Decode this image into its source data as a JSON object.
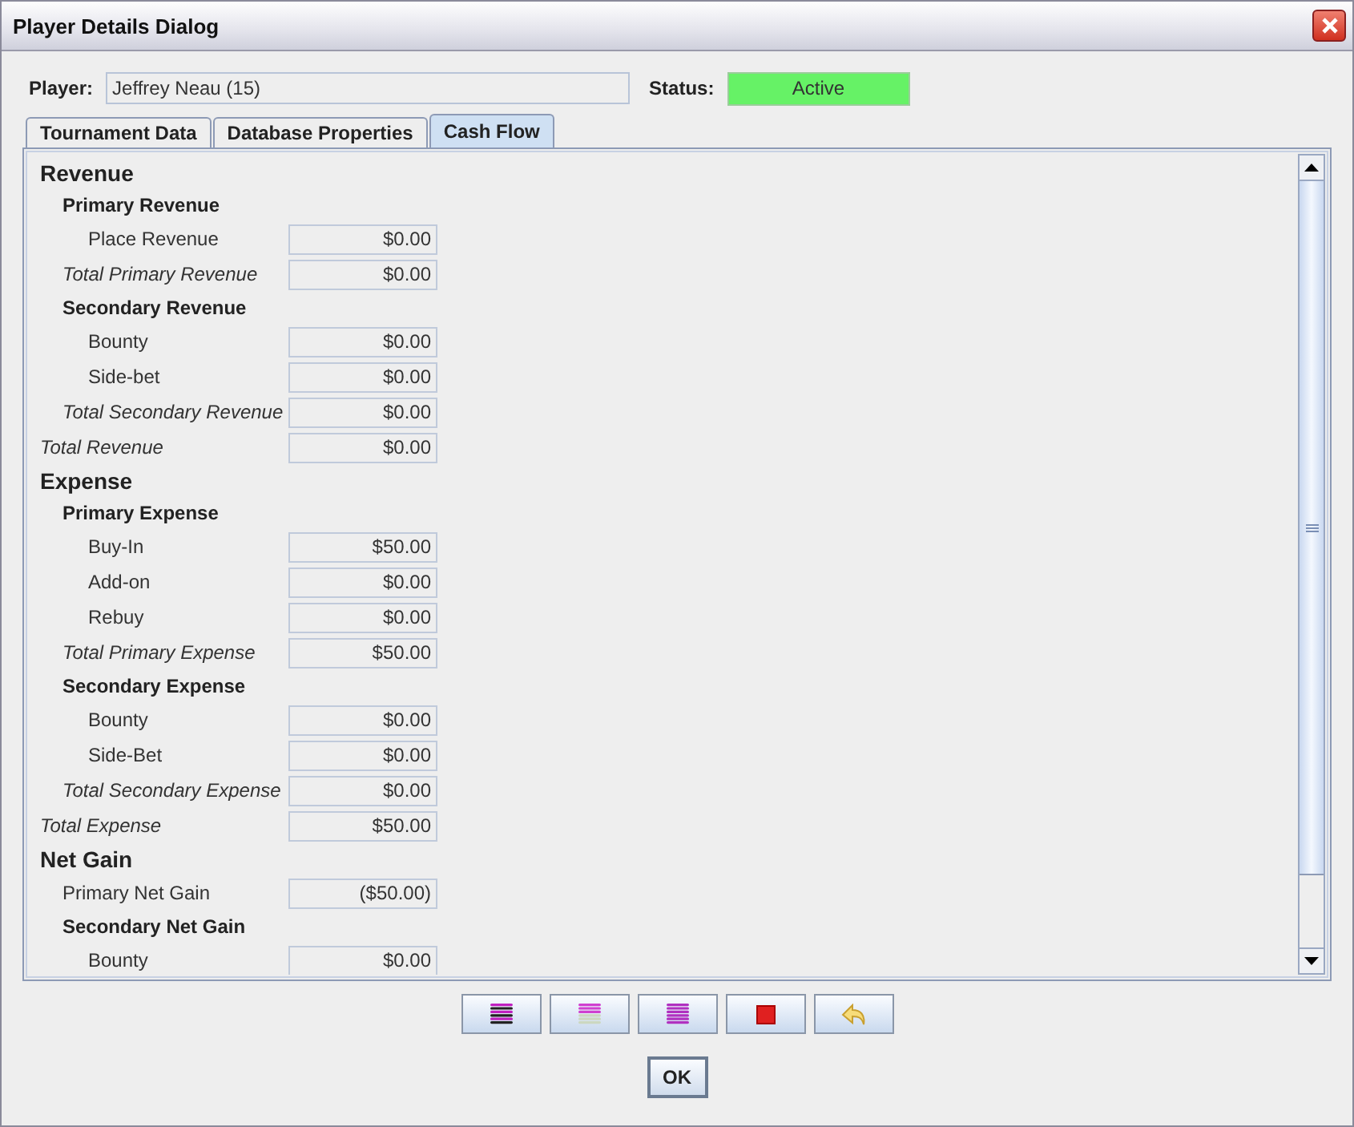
{
  "window": {
    "title": "Player Details Dialog"
  },
  "player": {
    "label": "Player:",
    "value": "Jeffrey Neau (15)"
  },
  "status": {
    "label": "Status:",
    "value": "Active",
    "color": "#66f266"
  },
  "tabs": [
    {
      "label": "Tournament Data",
      "selected": false
    },
    {
      "label": "Database Properties",
      "selected": false
    },
    {
      "label": "Cash Flow",
      "selected": true
    }
  ],
  "rows": [
    {
      "kind": "section",
      "label": "Revenue"
    },
    {
      "kind": "group",
      "label": "Primary Revenue"
    },
    {
      "kind": "item",
      "label": "Place Revenue",
      "value": "$0.00"
    },
    {
      "kind": "subtotal",
      "label": "Total Primary Revenue",
      "value": "$0.00"
    },
    {
      "kind": "group",
      "label": "Secondary Revenue"
    },
    {
      "kind": "item",
      "label": "Bounty",
      "value": "$0.00"
    },
    {
      "kind": "item",
      "label": "Side-bet",
      "value": "$0.00"
    },
    {
      "kind": "subtotal",
      "label": "Total Secondary Revenue",
      "value": "$0.00"
    },
    {
      "kind": "total",
      "label": "Total Revenue",
      "value": "$0.00"
    },
    {
      "kind": "section",
      "label": "Expense"
    },
    {
      "kind": "group",
      "label": "Primary Expense"
    },
    {
      "kind": "item",
      "label": "Buy-In",
      "value": "$50.00"
    },
    {
      "kind": "item",
      "label": "Add-on",
      "value": "$0.00"
    },
    {
      "kind": "item",
      "label": "Rebuy",
      "value": "$0.00"
    },
    {
      "kind": "subtotal",
      "label": "Total Primary Expense",
      "value": "$50.00"
    },
    {
      "kind": "group",
      "label": "Secondary Expense"
    },
    {
      "kind": "item",
      "label": "Bounty",
      "value": "$0.00"
    },
    {
      "kind": "item",
      "label": "Side-Bet",
      "value": "$0.00"
    },
    {
      "kind": "subtotal",
      "label": "Total Secondary Expense",
      "value": "$0.00"
    },
    {
      "kind": "total",
      "label": "Total Expense",
      "value": "$50.00"
    },
    {
      "kind": "section",
      "label": "Net Gain"
    },
    {
      "kind": "line",
      "label": "Primary Net Gain",
      "value": "($50.00)"
    },
    {
      "kind": "group",
      "label": "Secondary Net Gain"
    },
    {
      "kind": "item",
      "label": "Bounty",
      "value": "$0.00"
    }
  ],
  "toolbar": [
    {
      "kind": "stack-dark"
    },
    {
      "kind": "stack-light"
    },
    {
      "kind": "stack-full"
    },
    {
      "kind": "stop"
    },
    {
      "kind": "undo"
    }
  ],
  "ok_button": "OK"
}
